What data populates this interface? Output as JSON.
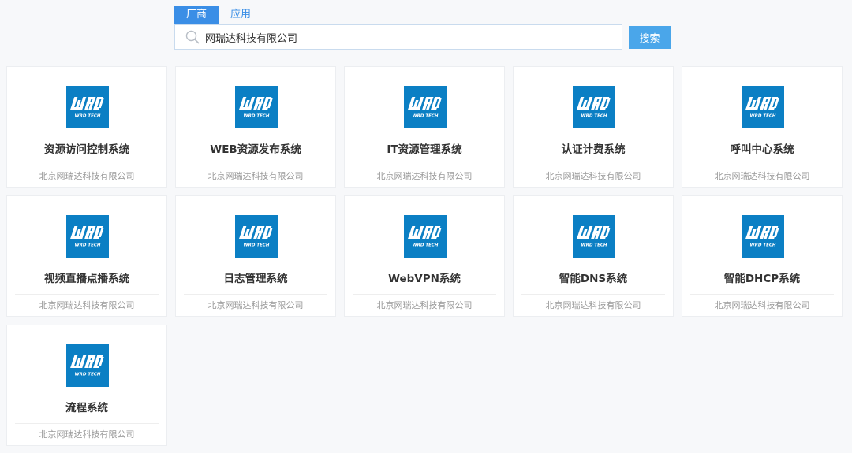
{
  "tabs": [
    {
      "label": "厂商",
      "active": true
    },
    {
      "label": "应用",
      "active": false
    }
  ],
  "search": {
    "value": "网瑞达科技有限公司",
    "button_label": "搜索"
  },
  "colors": {
    "accent": "#3a8ee6",
    "button": "#4aa6ea",
    "logo_bg": "#0b7fc4"
  },
  "logo": {
    "icon": "wrd-tech-logo",
    "text": "WRD TECH"
  },
  "cards": [
    {
      "title": "资源访问控制系统",
      "vendor": "北京网瑞达科技有限公司"
    },
    {
      "title": "WEB资源发布系统",
      "vendor": "北京网瑞达科技有限公司"
    },
    {
      "title": "IT资源管理系统",
      "vendor": "北京网瑞达科技有限公司"
    },
    {
      "title": "认证计费系统",
      "vendor": "北京网瑞达科技有限公司"
    },
    {
      "title": "呼叫中心系统",
      "vendor": "北京网瑞达科技有限公司"
    },
    {
      "title": "视频直播点播系统",
      "vendor": "北京网瑞达科技有限公司"
    },
    {
      "title": "日志管理系统",
      "vendor": "北京网瑞达科技有限公司"
    },
    {
      "title": "WebVPN系统",
      "vendor": "北京网瑞达科技有限公司"
    },
    {
      "title": "智能DNS系统",
      "vendor": "北京网瑞达科技有限公司"
    },
    {
      "title": "智能DHCP系统",
      "vendor": "北京网瑞达科技有限公司"
    },
    {
      "title": "流程系统",
      "vendor": "北京网瑞达科技有限公司"
    }
  ]
}
